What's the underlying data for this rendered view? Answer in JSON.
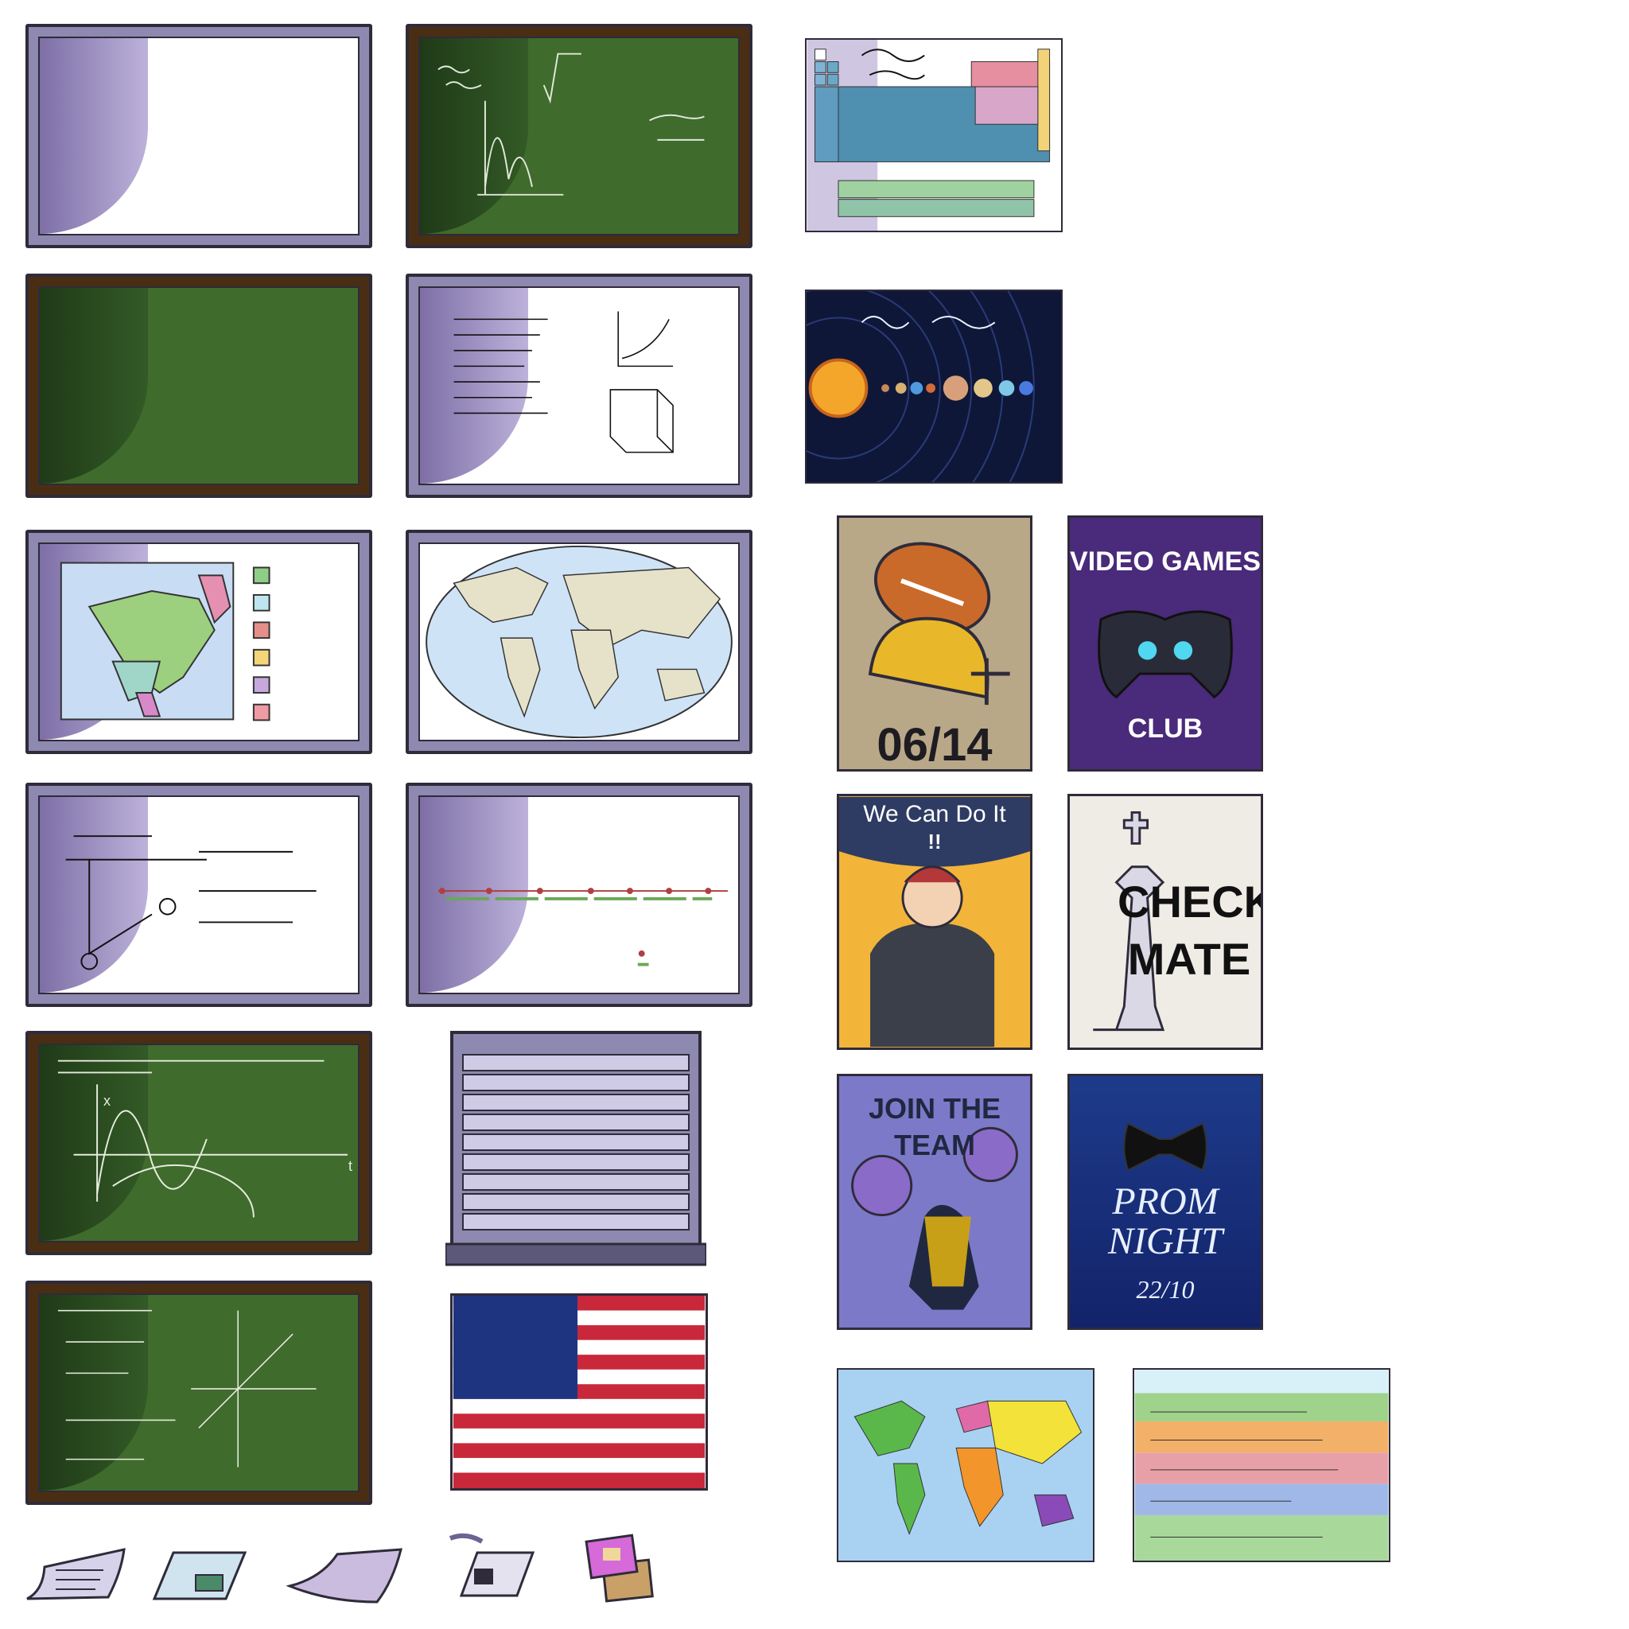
{
  "posters": {
    "football_date": "06/14",
    "video_games_top": "VIDEO GAMES",
    "video_games_bottom": "CLUB",
    "we_can": "We Can Do It",
    "we_can_excl": "!!",
    "check": "CHECK",
    "mate": "MATE",
    "join": "JOIN THE",
    "team": "TEAM",
    "prom": "PROM",
    "night": "NIGHT",
    "prom_date": "22/10"
  },
  "chalk": {
    "physics_axis_x": "x",
    "physics_axis_t": "t"
  },
  "colors": {
    "chalkboard_green": "#3f6b2c",
    "board_silver": "#8e89b0",
    "board_wood": "#4a2e14",
    "video_games_bg": "#4a2a7a",
    "prom_bg": "#1a2f7a",
    "join_team_bg": "#7b79c8",
    "we_can_bg": "#f3b43a",
    "football_bg": "#b9a888"
  }
}
